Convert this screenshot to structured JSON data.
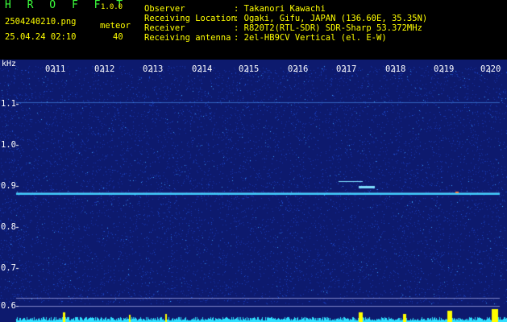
{
  "header": {
    "title": "H R O F F T",
    "version": "1.0.0",
    "filename": "2504240210.png",
    "datetime": "25.04.24 02:10",
    "meteor_label": "meteor",
    "meteor_count": "40"
  },
  "station": {
    "observer_label": "Observer",
    "observer_value": ": Takanori Kawachi",
    "location_label": "Receiving Location",
    "location_value": ": Ogaki, Gifu, JAPAN (136.60E, 35.35N)",
    "receiver_label": "Receiver",
    "receiver_value": ": R820T2(RTL-SDR) SDR-Sharp 53.372MHz",
    "antenna_label": "Receiving antenna",
    "antenna_value": ": 2el-HB9CV Vertical (el. E-W)"
  },
  "axis": {
    "unit": "kHz",
    "time_ticks": [
      "0211",
      "0212",
      "0213",
      "0214",
      "0215",
      "0216",
      "0217",
      "0218",
      "0219",
      "0220"
    ],
    "freq_ticks": [
      "1.1",
      "1.0",
      "0.9",
      "0.8",
      "0.7",
      "0.6"
    ]
  },
  "colors": {
    "background": "#0d1a6e",
    "carrier": "#40d0ff",
    "header_green": "#3cff3c",
    "header_yellow": "#ffff00",
    "bar_cyan": "#30e0ff",
    "bar_yellow": "#ffff00"
  }
}
